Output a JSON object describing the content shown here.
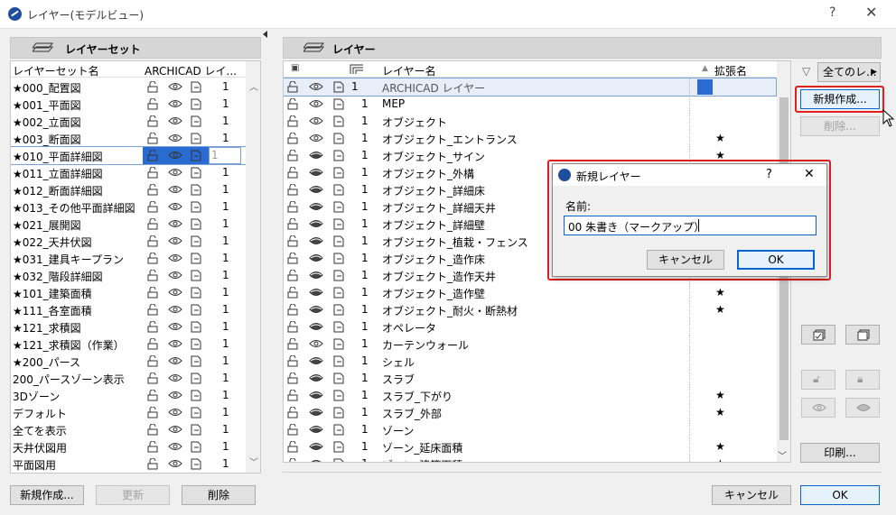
{
  "window": {
    "title": "レイヤー(モデルビュー)",
    "help": "?",
    "close": "✕"
  },
  "left": {
    "header": "レイヤーセット",
    "col_name": "レイヤーセット名",
    "col_archicad": "ARCHICAD レイ...",
    "rows": [
      {
        "name": "★000_配置図",
        "count": "1"
      },
      {
        "name": "★001_平面図",
        "count": "1"
      },
      {
        "name": "★002_立面図",
        "count": "1"
      },
      {
        "name": "★003_断面図",
        "count": "1"
      },
      {
        "name": "★010_平面詳細図",
        "count": "1",
        "selected": true
      },
      {
        "name": "★011_立面詳細図",
        "count": "1"
      },
      {
        "name": "★012_断面詳細図",
        "count": "1"
      },
      {
        "name": "★013_その他平面詳細図",
        "count": "1"
      },
      {
        "name": "★021_展開図",
        "count": "1"
      },
      {
        "name": "★022_天井伏図",
        "count": "1"
      },
      {
        "name": "★031_建具キープラン",
        "count": "1"
      },
      {
        "name": "★032_階段詳細図",
        "count": "1"
      },
      {
        "name": "★101_建築面積",
        "count": "1"
      },
      {
        "name": "★111_各室面積",
        "count": "1"
      },
      {
        "name": "★121_求積図",
        "count": "1"
      },
      {
        "name": "★121_求積図（作業）",
        "count": "1"
      },
      {
        "name": "★200_パース",
        "count": "1"
      },
      {
        "name": "200_パースゾーン表示",
        "count": "1"
      },
      {
        "name": "3Dゾーン",
        "count": "1"
      },
      {
        "name": "デフォルト",
        "count": "1"
      },
      {
        "name": "全てを表示",
        "count": "1"
      },
      {
        "name": "天井伏図用",
        "count": "1"
      },
      {
        "name": "平面図用",
        "count": "1"
      }
    ],
    "buttons": {
      "new": "新規作成...",
      "update": "更新",
      "delete": "削除"
    }
  },
  "right": {
    "header": "レイヤー",
    "col_name": "レイヤー名",
    "col_ext": "拡張名",
    "filter_label": "全てのレ...",
    "rows": [
      {
        "name": "ARCHICAD レイヤー",
        "count": "1",
        "star": "",
        "selected": true,
        "vis": "open"
      },
      {
        "name": "MEP",
        "count": "1",
        "star": "",
        "vis": "open"
      },
      {
        "name": "オブジェクト",
        "count": "1",
        "star": "",
        "vis": "open"
      },
      {
        "name": "オブジェクト_エントランス",
        "count": "1",
        "star": "★",
        "vis": "open"
      },
      {
        "name": "オブジェクト_サイン",
        "count": "1",
        "star": "★",
        "vis": "closed"
      },
      {
        "name": "オブジェクト_外構",
        "count": "1",
        "star": "",
        "vis": "closed"
      },
      {
        "name": "オブジェクト_詳細床",
        "count": "1",
        "star": "",
        "vis": "closed"
      },
      {
        "name": "オブジェクト_詳細天井",
        "count": "1",
        "star": "",
        "vis": "closed"
      },
      {
        "name": "オブジェクト_詳細壁",
        "count": "1",
        "star": "",
        "vis": "closed"
      },
      {
        "name": "オブジェクト_植栽・フェンス",
        "count": "1",
        "star": "",
        "vis": "closed"
      },
      {
        "name": "オブジェクト_造作床",
        "count": "1",
        "star": "",
        "vis": "closed"
      },
      {
        "name": "オブジェクト_造作天井",
        "count": "1",
        "star": "",
        "vis": "closed"
      },
      {
        "name": "オブジェクト_造作壁",
        "count": "1",
        "star": "★",
        "vis": "closed"
      },
      {
        "name": "オブジェクト_耐火・断熱材",
        "count": "1",
        "star": "★",
        "vis": "closed"
      },
      {
        "name": "オペレータ",
        "count": "1",
        "star": "",
        "vis": "closed"
      },
      {
        "name": "カーテンウォール",
        "count": "1",
        "star": "",
        "vis": "open"
      },
      {
        "name": "シェル",
        "count": "1",
        "star": "",
        "vis": "closed"
      },
      {
        "name": "スラブ",
        "count": "1",
        "star": "",
        "vis": "closed"
      },
      {
        "name": "スラブ_下がり",
        "count": "1",
        "star": "★",
        "vis": "closed"
      },
      {
        "name": "スラブ_外部",
        "count": "1",
        "star": "★",
        "vis": "closed"
      },
      {
        "name": "ゾーン",
        "count": "1",
        "star": "",
        "vis": "closed"
      },
      {
        "name": "ゾーン_延床面積",
        "count": "1",
        "star": "★",
        "vis": "closed"
      },
      {
        "name": "ゾーン_建築面積",
        "count": "1",
        "star": "★",
        "vis": "closed"
      }
    ],
    "buttons": {
      "new": "新規作成...",
      "delete": "削除...",
      "print": "印刷...",
      "cancel": "キャンセル",
      "ok": "OK"
    }
  },
  "dialog": {
    "title": "新規レイヤー",
    "help": "?",
    "close": "✕",
    "name_label": "名前:",
    "name_value": "00  朱書き（マークアップ）",
    "cancel": "キャンセル",
    "ok": "OK"
  },
  "accent": "#0a64d0",
  "highlight": "#e02020"
}
